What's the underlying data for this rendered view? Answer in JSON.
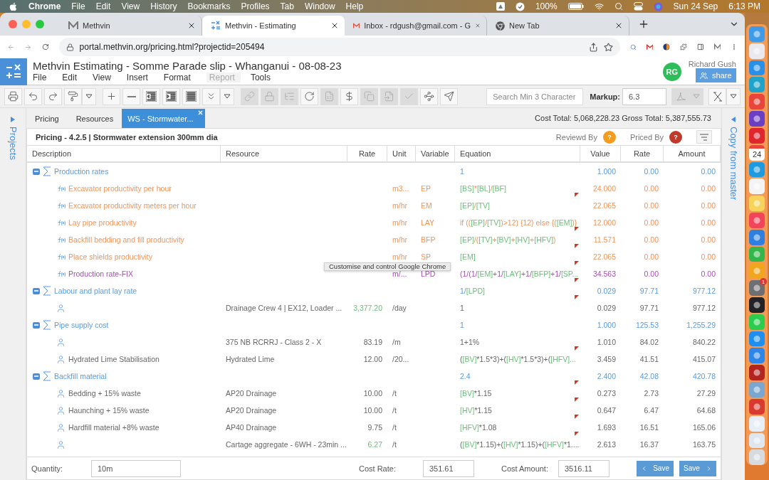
{
  "menubar": {
    "app": "Chrome",
    "menus": [
      "File",
      "Edit",
      "View",
      "History",
      "Bookmarks",
      "Profiles",
      "Tab",
      "Window",
      "Help"
    ],
    "battery": "100%",
    "date": "Sun 24 Sep",
    "time": "6:13 PM"
  },
  "browser": {
    "tabs": [
      {
        "title": "Methvin",
        "kind": "methvin",
        "selected": false
      },
      {
        "title": "Methvin - Estimating",
        "kind": "estimating",
        "selected": true
      },
      {
        "title": "Inbox - rdgush@gmail.com - G",
        "kind": "mail",
        "selected": false
      },
      {
        "title": "New Tab",
        "kind": "chrome",
        "selected": false
      }
    ],
    "url": "portal.methvin.org/pricing.html?projectid=205494",
    "tooltip": "Customise and control Google Chrome"
  },
  "app": {
    "title": "Methvin Estimating - Somme Parade slip - Whanganui - 08-08-23",
    "menu": [
      {
        "label": "File",
        "disabled": false
      },
      {
        "label": "Edit",
        "disabled": false
      },
      {
        "label": "View",
        "disabled": false
      },
      {
        "label": "Insert",
        "disabled": false
      },
      {
        "label": "Format",
        "disabled": false
      },
      {
        "label": "Report",
        "disabled": true
      },
      {
        "label": "Tools",
        "disabled": false
      }
    ],
    "user": {
      "initials": "RG",
      "name": "Richard Gush"
    },
    "share": "share"
  },
  "toolbar": {
    "buttons": [
      {
        "kind": "print",
        "disabled": false
      },
      {
        "kind": "undo",
        "disabled": false
      },
      {
        "kind": "redo",
        "disabled": false
      },
      {
        "kind": "paint",
        "disabled": false
      },
      {
        "kind": "caret",
        "disabled": false
      },
      {
        "kind": "add",
        "disabled": false
      },
      {
        "kind": "remove",
        "disabled": false
      },
      {
        "kind": "outdent",
        "disabled": false
      },
      {
        "kind": "indent",
        "disabled": false
      },
      {
        "kind": "justify",
        "disabled": false
      },
      {
        "kind": "expand",
        "disabled": false
      },
      {
        "kind": "caret",
        "disabled": false
      },
      {
        "kind": "link",
        "disabled": true
      },
      {
        "kind": "lock",
        "disabled": true
      },
      {
        "kind": "tree",
        "disabled": true
      },
      {
        "kind": "refresh",
        "disabled": false
      },
      {
        "kind": "sheet",
        "disabled": true
      },
      {
        "kind": "dollar",
        "disabled": false
      },
      {
        "kind": "copy",
        "disabled": true
      },
      {
        "kind": "import",
        "disabled": true
      },
      {
        "kind": "check",
        "disabled": true
      },
      {
        "kind": "select",
        "disabled": false
      },
      {
        "kind": "send",
        "disabled": false
      }
    ],
    "search_placeholder": "Search Min 3 Character",
    "markup_label": "Markup:",
    "markup": "6.3",
    "exports": [
      {
        "kind": "pdf",
        "disabled": true
      },
      {
        "kind": "excel",
        "disabled": false
      }
    ]
  },
  "left_sidebar": "Projects",
  "right_sidebar": "Copy from master",
  "tabs": [
    {
      "label": "Pricing",
      "selected": false,
      "closable": false
    },
    {
      "label": "Resources",
      "selected": false,
      "closable": false
    },
    {
      "label": "WS - Stormwater...",
      "selected": true,
      "closable": true
    }
  ],
  "totals": "Cost Total: 5,068,228.23 Gross Total: 5,387,555.73",
  "panel": {
    "title": "Pricing - 4.2.5 | Stormwater extension 300mm dia",
    "reviewers": [
      {
        "label": "Reviewd By",
        "mark": "?",
        "color": "#f39c1f"
      },
      {
        "label": "Priced By",
        "mark": "?",
        "color": "#c0392b"
      }
    ]
  },
  "table": {
    "columns": [
      "Description",
      "Resource",
      "Rate",
      "Unit",
      "Variable",
      "Equation",
      "Value",
      "Rate",
      "Amount"
    ],
    "rows": [
      {
        "kind": "group",
        "description": "Production rates",
        "expanded": true,
        "equation": [
          {
            "kind": "op",
            "text": "1"
          }
        ],
        "value": "1.000",
        "rate": "0.00",
        "amount": "0.00",
        "note": false,
        "children": [
          {
            "kind": "formula",
            "color": "#f0955a",
            "description": "Excavator productivity per hour",
            "unit": "m3...",
            "variable": "EP",
            "equation": [
              {
                "kind": "var",
                "text": "[BS]"
              },
              {
                "kind": "op",
                "text": "*"
              },
              {
                "kind": "var",
                "text": "[BL]"
              },
              {
                "kind": "op",
                "text": "/"
              },
              {
                "kind": "var",
                "text": "[BF]"
              }
            ],
            "value": "24.000",
            "rate": "0.00",
            "amount": "0.00",
            "note": false
          },
          {
            "kind": "formula",
            "color": "#f0955a",
            "description": "Excavator productivity meters per hour",
            "unit": "m/hr",
            "variable": "EM",
            "equation": [
              {
                "kind": "var",
                "text": "[EP]"
              },
              {
                "kind": "op",
                "text": "/"
              },
              {
                "kind": "var",
                "text": "[TV]"
              }
            ],
            "value": "22.065",
            "rate": "0.00",
            "amount": "0.00",
            "note": true
          },
          {
            "kind": "formula",
            "color": "#f0955a",
            "description": "Lay pipe productivity",
            "unit": "m/hr",
            "variable": "LAY",
            "equation": [
              {
                "kind": "op",
                "text": "if (("
              },
              {
                "kind": "var",
                "text": "[EP]"
              },
              {
                "kind": "op",
                "text": "/"
              },
              {
                "kind": "var",
                "text": "[TV]"
              },
              {
                "kind": "op",
                "text": ")>12) {12} else {("
              },
              {
                "kind": "var",
                "text": "[EM]"
              },
              {
                "kind": "op",
                "text": ")}"
              }
            ],
            "value": "12.000",
            "rate": "0.00",
            "amount": "0.00",
            "note": false
          },
          {
            "kind": "formula",
            "color": "#f0955a",
            "description": "Backfill bedding and fill productivity",
            "unit": "m/hr",
            "variable": "BFP",
            "equation": [
              {
                "kind": "var",
                "text": "[EP]"
              },
              {
                "kind": "op",
                "text": "/("
              },
              {
                "kind": "var",
                "text": "[TV]"
              },
              {
                "kind": "op",
                "text": "+"
              },
              {
                "kind": "var",
                "text": "[BV]"
              },
              {
                "kind": "op",
                "text": "+"
              },
              {
                "kind": "var",
                "text": "[HV]"
              },
              {
                "kind": "op",
                "text": "+"
              },
              {
                "kind": "var",
                "text": "[HFV]"
              },
              {
                "kind": "op",
                "text": ")"
              }
            ],
            "value": "11.571",
            "rate": "0.00",
            "amount": "0.00",
            "note": true
          },
          {
            "kind": "formula",
            "color": "#f0955a",
            "description": "Place shields productivity",
            "unit": "m/hr",
            "variable": "SP",
            "equation": [
              {
                "kind": "var",
                "text": "[EM]"
              }
            ],
            "value": "22.065",
            "rate": "0.00",
            "amount": "0.00",
            "note": true
          },
          {
            "kind": "formula",
            "color": "#a64db4",
            "description": "Production rate-FIX",
            "unit": "m/...",
            "variable": "LPD",
            "equation": [
              {
                "kind": "op",
                "text": "(1/(1/"
              },
              {
                "kind": "var",
                "text": "[EM]"
              },
              {
                "kind": "op",
                "text": "+1/"
              },
              {
                "kind": "var",
                "text": "[LAY]"
              },
              {
                "kind": "op",
                "text": "+1/"
              },
              {
                "kind": "var",
                "text": "[BFP]"
              },
              {
                "kind": "op",
                "text": "+1/"
              },
              {
                "kind": "var",
                "text": "[SP..."
              }
            ],
            "value": "34.563",
            "rate": "0.00",
            "amount": "0.00",
            "note": true
          }
        ]
      },
      {
        "kind": "group",
        "description": "Labour and plant lay rate",
        "expanded": true,
        "equation": [
          {
            "kind": "op",
            "text": "1/"
          },
          {
            "kind": "var",
            "text": "[LPD]"
          }
        ],
        "value": "0.029",
        "rate": "97.71",
        "amount": "977.12",
        "note": true,
        "children": [
          {
            "kind": "resource",
            "resource": "Drainage Crew 4 | EX12, Loader ...",
            "resource_rate": "3,377.20",
            "rate_linked": true,
            "unit": "/day",
            "equation": [
              {
                "kind": "op",
                "text": "1"
              }
            ],
            "value": "0.029",
            "rate": "97.71",
            "amount": "977.12",
            "note": true
          }
        ]
      },
      {
        "kind": "group",
        "description": "Pipe supply cost",
        "expanded": true,
        "equation": [
          {
            "kind": "op",
            "text": "1"
          }
        ],
        "value": "1.000",
        "rate": "125.53",
        "amount": "1,255.29",
        "note": false,
        "children": [
          {
            "kind": "resource",
            "resource": "375 NB RCRRJ - Class 2 - X",
            "resource_rate": "83.19",
            "rate_linked": false,
            "unit": "/m",
            "equation": [
              {
                "kind": "op",
                "text": "1+1%"
              }
            ],
            "value": "1.010",
            "rate": "84.02",
            "amount": "840.22",
            "note": false
          },
          {
            "kind": "resource",
            "description": "Hydrated Lime Stabilisation",
            "resource": "Hydrated Lime",
            "resource_rate": "12.00",
            "rate_linked": false,
            "unit": "/20...",
            "equation": [
              {
                "kind": "op",
                "text": "("
              },
              {
                "kind": "var",
                "text": "[BV]"
              },
              {
                "kind": "op",
                "text": "*1.5*3)+("
              },
              {
                "kind": "var",
                "text": "[HV]"
              },
              {
                "kind": "op",
                "text": "*1.5*3)+("
              },
              {
                "kind": "var",
                "text": "[HFV]..."
              }
            ],
            "value": "3.459",
            "rate": "41.51",
            "amount": "415.07",
            "note": true
          }
        ]
      },
      {
        "kind": "group",
        "description": "Backfill material",
        "expanded": true,
        "equation": [
          {
            "kind": "op",
            "text": "2.4"
          }
        ],
        "value": "2.400",
        "rate": "42.08",
        "amount": "420.78",
        "note": false,
        "children": [
          {
            "kind": "resource",
            "description": "Bedding + 15% waste",
            "resource": "AP20 Drainage",
            "resource_rate": "10.00",
            "rate_linked": false,
            "unit": "/t",
            "equation": [
              {
                "kind": "var",
                "text": "[BV]"
              },
              {
                "kind": "op",
                "text": "*1.15"
              }
            ],
            "value": "0.273",
            "rate": "2.73",
            "amount": "27.29",
            "note": true
          },
          {
            "kind": "resource",
            "description": "Haunching + 15% waste",
            "resource": "AP20 Drainage",
            "resource_rate": "10.00",
            "rate_linked": false,
            "unit": "/t",
            "equation": [
              {
                "kind": "var",
                "text": "[HV]"
              },
              {
                "kind": "op",
                "text": "*1.15"
              }
            ],
            "value": "0.647",
            "rate": "6.47",
            "amount": "64.68",
            "note": true
          },
          {
            "kind": "resource",
            "description": "Hardfill material +8% waste",
            "resource": "AP40 Drainage",
            "resource_rate": "9.75",
            "rate_linked": false,
            "unit": "/t",
            "equation": [
              {
                "kind": "var",
                "text": "[HFV]"
              },
              {
                "kind": "op",
                "text": "*1.08"
              }
            ],
            "value": "1.693",
            "rate": "16.51",
            "amount": "165.06",
            "note": true
          },
          {
            "kind": "resource",
            "resource": "Cartage aggregate - 6WH - 23min ...",
            "resource_rate": "6.27",
            "rate_linked": true,
            "unit": "/t",
            "equation": [
              {
                "kind": "op",
                "text": "("
              },
              {
                "kind": "var",
                "text": "[BV]"
              },
              {
                "kind": "op",
                "text": "*1.15)+("
              },
              {
                "kind": "var",
                "text": "[HV]"
              },
              {
                "kind": "op",
                "text": "*1.15)+("
              },
              {
                "kind": "var",
                "text": "[HFV]"
              },
              {
                "kind": "op",
                "text": "*1...."
              }
            ],
            "value": "2.613",
            "rate": "16.37",
            "amount": "163.75",
            "note": true
          }
        ]
      }
    ]
  },
  "footer": {
    "quantity_label": "Quantity:",
    "quantity": "10m",
    "cost_rate_label": "Cost Rate:",
    "cost_rate": "351.61",
    "cost_amount_label": "Cost Amount:",
    "cost_amount": "3516.11",
    "buttons": [
      {
        "kind": "previous",
        "label": "Save"
      },
      {
        "kind": "next",
        "label": "Save"
      }
    ]
  },
  "dock": [
    {
      "kind": "app",
      "color": "#3f9be8"
    },
    {
      "kind": "app",
      "color": "#e9e9ee"
    },
    {
      "kind": "app",
      "color": "#2a8fe6"
    },
    {
      "kind": "app",
      "color": "#1fa3c9"
    },
    {
      "kind": "app",
      "color": "#e8453c"
    },
    {
      "kind": "app",
      "color": "#6b3fc4"
    },
    {
      "kind": "app",
      "color": "#e0262d"
    },
    {
      "kind": "calendar",
      "label": "24"
    },
    {
      "kind": "app",
      "color": "#1e9ae0"
    },
    {
      "kind": "app",
      "color": "#f4f4f4"
    },
    {
      "kind": "app",
      "color": "#f6d35a"
    },
    {
      "kind": "app",
      "color": "#f2455a"
    },
    {
      "kind": "app",
      "color": "#2f7fe0"
    },
    {
      "kind": "app",
      "color": "#35b64a"
    },
    {
      "kind": "app",
      "color": "#f2a51f"
    },
    {
      "kind": "app",
      "color": "#6e6e73",
      "badge": "1"
    },
    {
      "kind": "app",
      "color": "#222226"
    },
    {
      "kind": "app",
      "color": "#2ccc4f"
    },
    {
      "kind": "app",
      "color": "#1f8ef1"
    },
    {
      "kind": "app",
      "color": "#2d86e8"
    },
    {
      "kind": "app",
      "color": "#b3241f"
    },
    {
      "kind": "app",
      "color": "#7aa6cf"
    },
    {
      "kind": "app",
      "color": "#d83a2f"
    },
    {
      "kind": "app",
      "color": "#e8eef6"
    },
    {
      "kind": "app",
      "color": "#dfe6ef"
    },
    {
      "kind": "app",
      "color": "#d7dbe0"
    }
  ]
}
